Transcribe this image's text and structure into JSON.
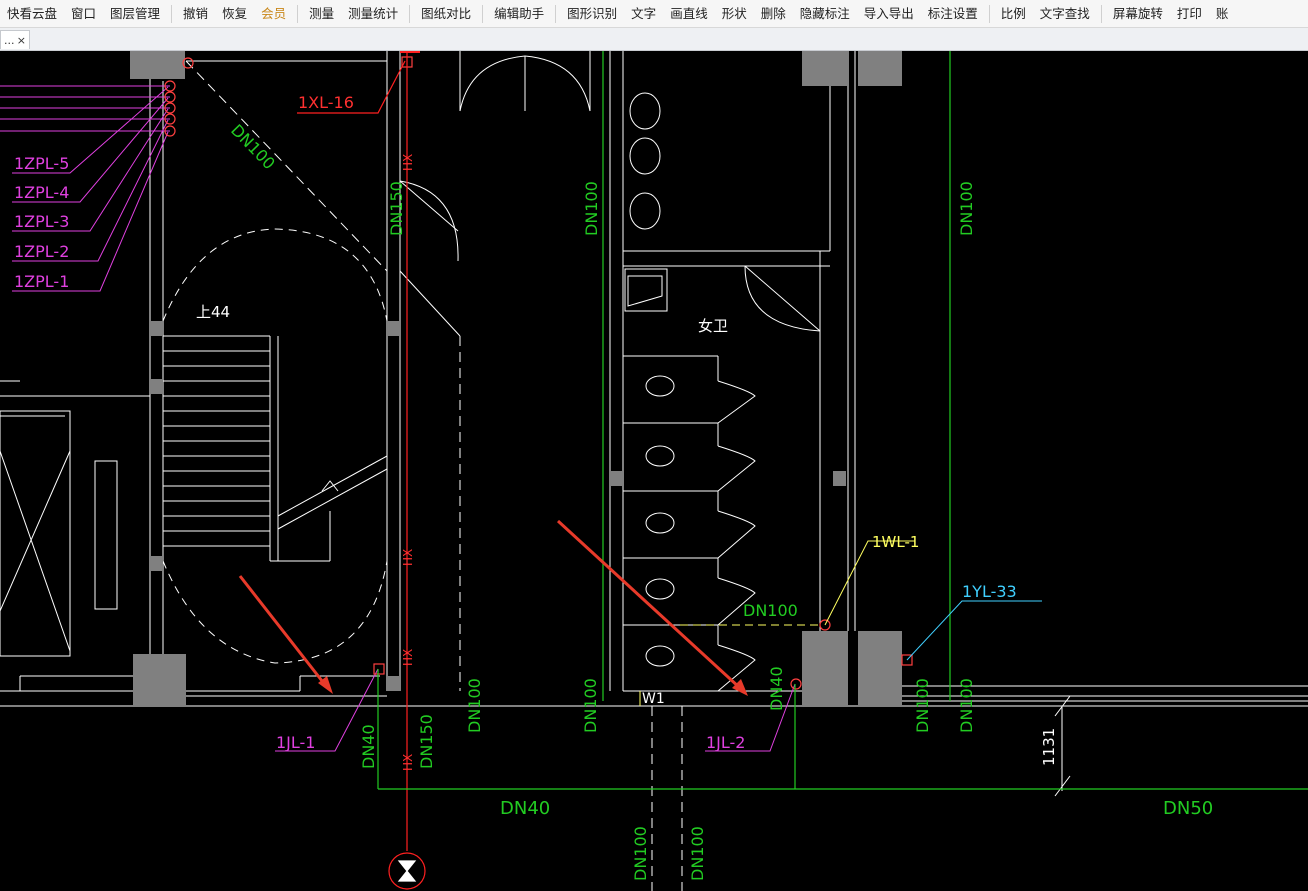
{
  "toolbar": {
    "items": [
      "快看云盘",
      "窗口",
      "图层管理",
      "撤销",
      "恢复",
      "会员",
      "测量",
      "测量统计",
      "图纸对比",
      "编辑助手",
      "图形识别",
      "文字",
      "画直线",
      "形状",
      "删除",
      "隐藏标注",
      "导入导出",
      "标注设置",
      "比例",
      "文字查找",
      "屏幕旋转",
      "打印",
      "账"
    ]
  },
  "tab": {
    "label": "...",
    "close": "×"
  },
  "drawing": {
    "labels": {
      "xl16": "1XL-16",
      "zpl5": "1ZPL-5",
      "zpl4": "1ZPL-4",
      "zpl3": "1ZPL-3",
      "zpl2": "1ZPL-2",
      "zpl1": "1ZPL-1",
      "dn100_diag": "DN100",
      "dn150_top": "DN150",
      "hx1": "HX",
      "hx2": "HX",
      "hx3": "HX",
      "hx4": "HX",
      "dn100_v1": "DN100",
      "dn100_v2": "DN100",
      "up44": "上44",
      "nvwei": "女卫",
      "wl1": "1WL-1",
      "yl33": "1YL-33",
      "dn100_h": "DN100",
      "dn40_v": "DN40",
      "jl1": "1JL-1",
      "jl2": "1JL-2",
      "dn40_low": "DN40",
      "dn150_low": "DN150",
      "dn100_low1": "DN100",
      "dn100_low2": "DN100",
      "dn100_low3": "DN100",
      "dn100_low4": "DN100",
      "w1": "W1",
      "dn40_h": "DN40",
      "dn50_h": "DN50",
      "dim1131": "1131",
      "dn100_bot1": "DN100",
      "dn100_bot2": "DN100"
    },
    "colors": {
      "background": "#000000",
      "wall": "#ffffff",
      "pipe_red": "#ff2020",
      "pipe_green": "#22cc22",
      "label_magenta": "#e040e0",
      "label_yellow": "#ffff60",
      "label_cyan": "#40d0ff",
      "column": "#808080",
      "arrow": "#e83a2a"
    }
  }
}
